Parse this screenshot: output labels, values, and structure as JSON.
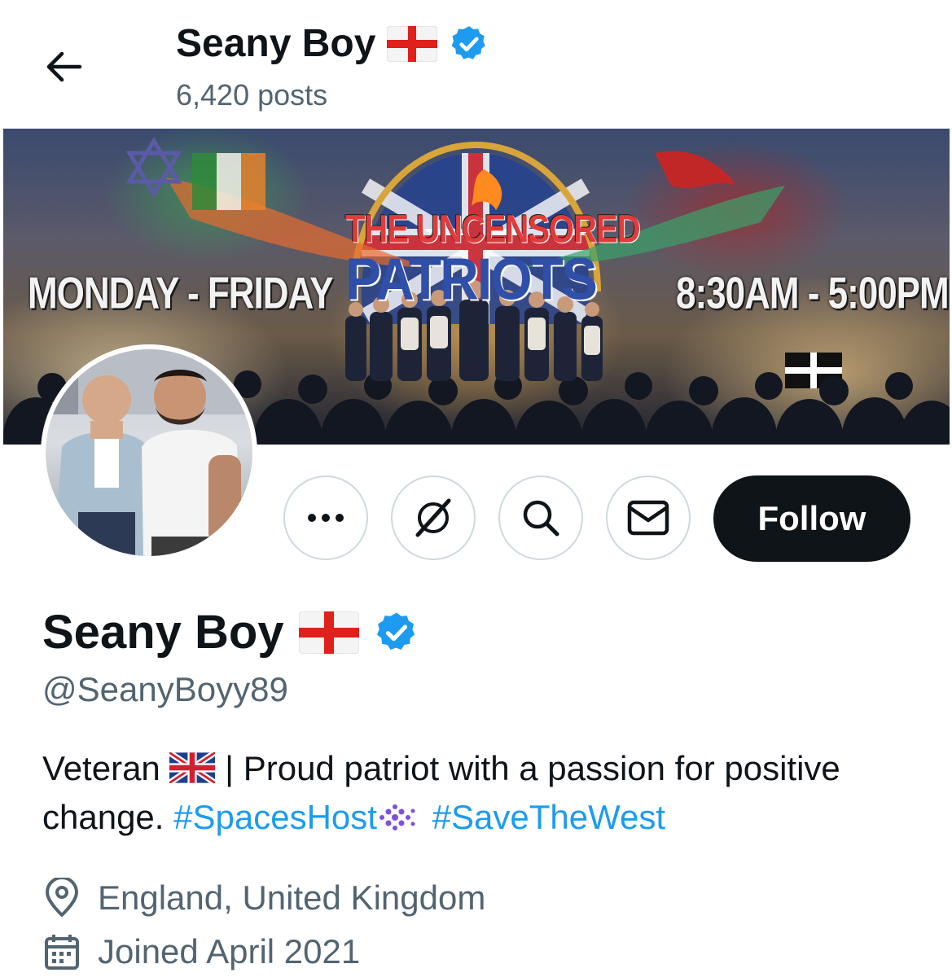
{
  "header": {
    "name": "Seany Boy",
    "posts_count": "6,420 posts"
  },
  "banner": {
    "left_text": "MONDAY - FRIDAY",
    "right_text": "8:30AM - 5:00PM",
    "title_line1": "THE UNCENSORED",
    "title_line2": "PATRIOTS"
  },
  "actions": {
    "more_icon": "more-horizontal-icon",
    "grok_icon": "grok-icon",
    "search_icon": "search-icon",
    "message_icon": "envelope-icon",
    "follow_label": "Follow"
  },
  "profile": {
    "name": "Seany Boy",
    "handle": "@SeanyBoyy89",
    "bio_prefix": "Veteran",
    "bio_text": "| Proud patriot with a passion for positive change.",
    "hashtag1": "#SpacesHost",
    "hashtag2": "#SaveTheWest",
    "location": "England, United Kingdom",
    "joined": "Joined April 2021",
    "verified_color": "#1d9bf0"
  },
  "colors": {
    "text_primary": "#0f1419",
    "text_secondary": "#536471",
    "link": "#1d9bf0",
    "follow_bg": "#0f1419"
  }
}
